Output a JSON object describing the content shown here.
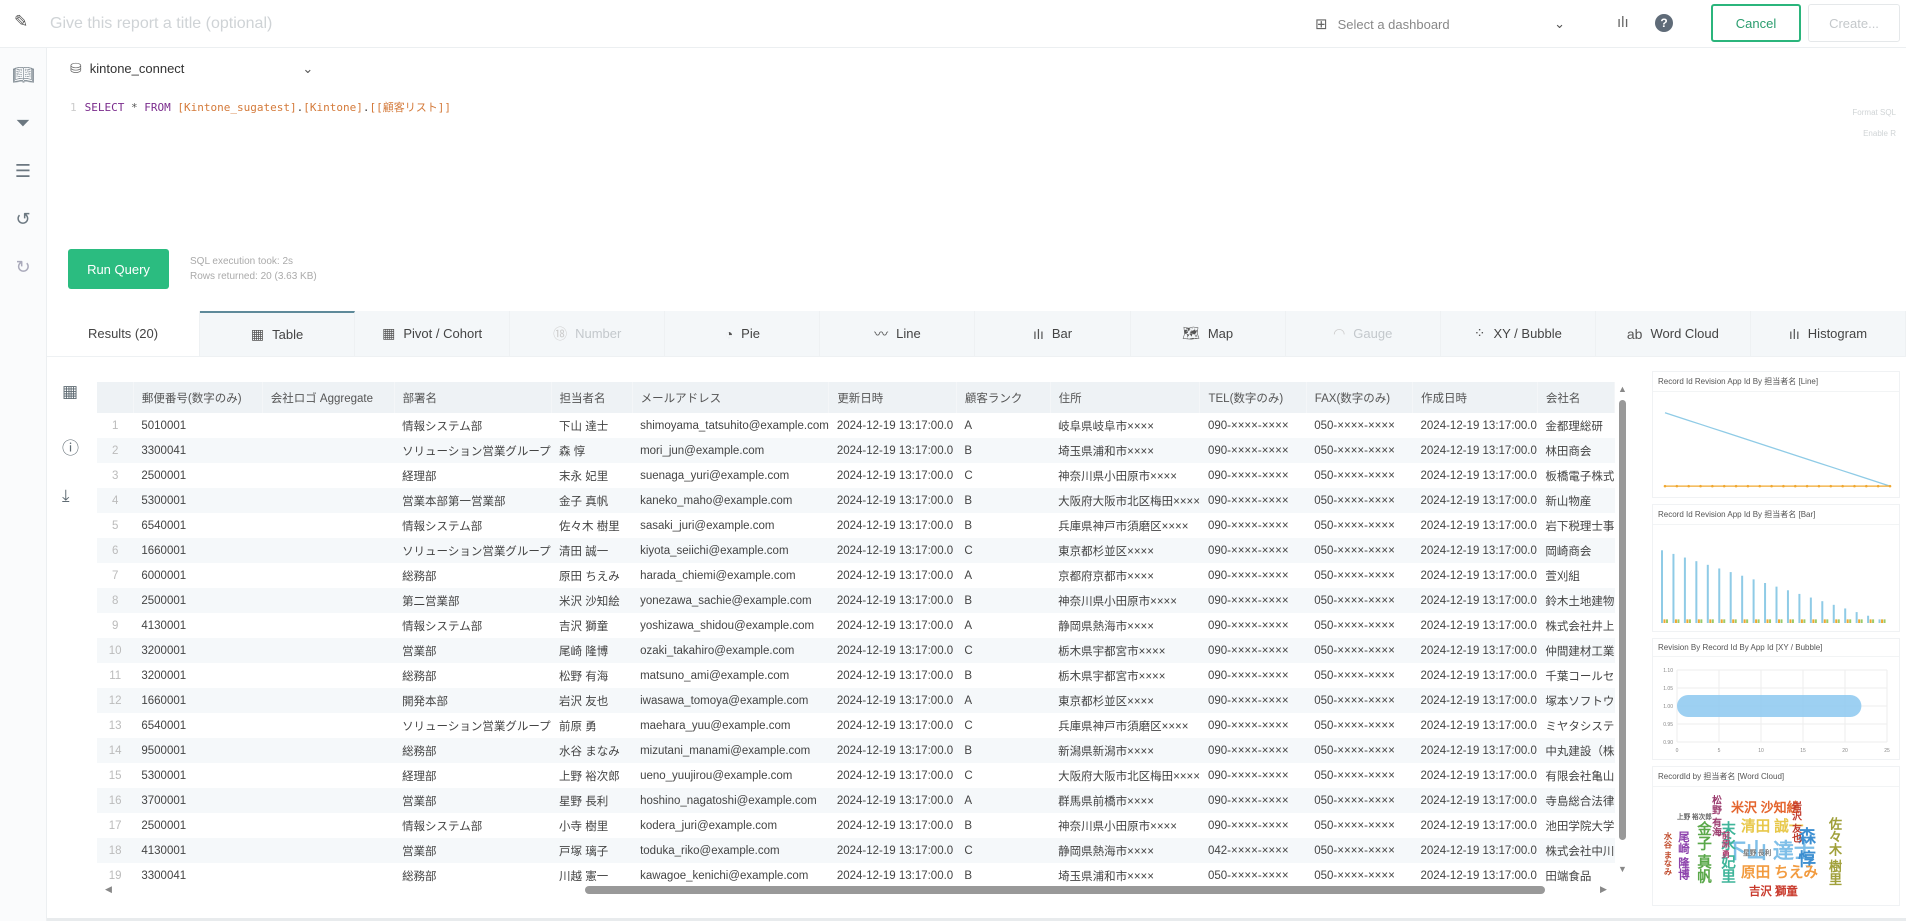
{
  "header": {
    "title_placeholder": "Give this report a title (optional)",
    "dashboard_placeholder": "Select a dashboard",
    "cancel_label": "Cancel",
    "create_label": "Create..."
  },
  "editor": {
    "connection": "kintone_connect",
    "line_number": "1",
    "sql": {
      "select": "SELECT",
      "star": " * ",
      "from": "FROM",
      "db": " [Kintone_sugatest]",
      "dot1": ".",
      "schema": "[Kintone]",
      "dot2": ".",
      "table": "[[顧客リスト]]"
    },
    "format_sql": "Format SQL",
    "enable_r": "Enable R",
    "run_label": "Run Query",
    "exec_time": "SQL execution took: 2s",
    "rows_returned": "Rows returned: 20 (3.63 KB)"
  },
  "tabs": [
    {
      "label": "Results (20)",
      "icon": "",
      "state": "active"
    },
    {
      "label": "Table",
      "icon": "table-icon",
      "state": "normal"
    },
    {
      "label": "Pivot / Cohort",
      "icon": "pivot-icon",
      "state": "normal"
    },
    {
      "label": "Number",
      "icon": "number-icon",
      "state": "disabled"
    },
    {
      "label": "Pie",
      "icon": "pie-icon",
      "state": "normal"
    },
    {
      "label": "Line",
      "icon": "line-icon",
      "state": "normal"
    },
    {
      "label": "Bar",
      "icon": "bar-icon",
      "state": "normal"
    },
    {
      "label": "Map",
      "icon": "map-icon",
      "state": "normal"
    },
    {
      "label": "Gauge",
      "icon": "gauge-icon",
      "state": "disabled"
    },
    {
      "label": "XY / Bubble",
      "icon": "bubble-icon",
      "state": "normal"
    },
    {
      "label": "Word Cloud",
      "icon": "word-cloud-icon",
      "state": "normal"
    },
    {
      "label": "Histogram",
      "icon": "histogram-icon",
      "state": "normal"
    }
  ],
  "table": {
    "columns": [
      "",
      "郵便番号(数字のみ)",
      "会社ロゴ Aggregate",
      "部署名",
      "担当者名",
      "メールアドレス",
      "更新日時",
      "顧客ランク",
      "住所",
      "TEL(数字のみ)",
      "FAX(数字のみ)",
      "作成日時",
      "会社名"
    ],
    "rows": [
      [
        "1",
        "5010001",
        "",
        "情報システム部",
        "下山 達士",
        "shimoyama_tatsuhito@example.com",
        "2024-12-19 13:17:00.0",
        "A",
        "岐阜県岐阜市××××",
        "090-××××-××××",
        "050-××××-××××",
        "2024-12-19 13:17:00.0",
        "金都理総研"
      ],
      [
        "2",
        "3300041",
        "",
        "ソリューション営業グループ",
        "森 惇",
        "mori_jun@example.com",
        "2024-12-19 13:17:00.0",
        "B",
        "埼玉県浦和市××××",
        "090-××××-××××",
        "050-××××-××××",
        "2024-12-19 13:17:00.0",
        "林田商会"
      ],
      [
        "3",
        "2500001",
        "",
        "経理部",
        "末永 妃里",
        "suenaga_yuri@example.com",
        "2024-12-19 13:17:00.0",
        "C",
        "神奈川県小田原市××××",
        "090-××××-××××",
        "050-××××-××××",
        "2024-12-19 13:17:00.0",
        "板橋電子株式"
      ],
      [
        "4",
        "5300001",
        "",
        "営業本部第一営業部",
        "金子 真帆",
        "kaneko_maho@example.com",
        "2024-12-19 13:17:00.0",
        "B",
        "大阪府大阪市北区梅田××××",
        "090-××××-××××",
        "050-××××-××××",
        "2024-12-19 13:17:00.0",
        "新山物産"
      ],
      [
        "5",
        "6540001",
        "",
        "情報システム部",
        "佐々木 樹里",
        "sasaki_juri@example.com",
        "2024-12-19 13:17:00.0",
        "B",
        "兵庫県神戸市須磨区××××",
        "090-××××-××××",
        "050-××××-××××",
        "2024-12-19 13:17:00.0",
        "岩下税理士事"
      ],
      [
        "6",
        "1660001",
        "",
        "ソリューション営業グループ",
        "清田 誠一",
        "kiyota_seiichi@example.com",
        "2024-12-19 13:17:00.0",
        "C",
        "東京都杉並区××××",
        "090-××××-××××",
        "050-××××-××××",
        "2024-12-19 13:17:00.0",
        "岡崎商会"
      ],
      [
        "7",
        "6000001",
        "",
        "総務部",
        "原田 ちえみ",
        "harada_chiemi@example.com",
        "2024-12-19 13:17:00.0",
        "A",
        "京都府京都市××××",
        "090-××××-××××",
        "050-××××-××××",
        "2024-12-19 13:17:00.0",
        "萱刈組"
      ],
      [
        "8",
        "2500001",
        "",
        "第二営業部",
        "米沢 沙知絵",
        "yonezawa_sachie@example.com",
        "2024-12-19 13:17:00.0",
        "B",
        "神奈川県小田原市××××",
        "090-××××-××××",
        "050-××××-××××",
        "2024-12-19 13:17:00.0",
        "鈴木土地建物"
      ],
      [
        "9",
        "4130001",
        "",
        "情報システム部",
        "吉沢 獅童",
        "yoshizawa_shidou@example.com",
        "2024-12-19 13:17:00.0",
        "A",
        "静岡県熱海市××××",
        "090-××××-××××",
        "050-××××-××××",
        "2024-12-19 13:17:00.0",
        "株式会社井上"
      ],
      [
        "10",
        "3200001",
        "",
        "営業部",
        "尾崎 隆博",
        "ozaki_takahiro@example.com",
        "2024-12-19 13:17:00.0",
        "C",
        "栃木県宇都宮市××××",
        "090-××××-××××",
        "050-××××-××××",
        "2024-12-19 13:17:00.0",
        "仲間建材工業"
      ],
      [
        "11",
        "3200001",
        "",
        "総務部",
        "松野 有海",
        "matsuno_ami@example.com",
        "2024-12-19 13:17:00.0",
        "B",
        "栃木県宇都宮市××××",
        "090-××××-××××",
        "050-××××-××××",
        "2024-12-19 13:17:00.0",
        "千葉コールセ"
      ],
      [
        "12",
        "1660001",
        "",
        "開発本部",
        "岩沢 友也",
        "iwasawa_tomoya@example.com",
        "2024-12-19 13:17:00.0",
        "A",
        "東京都杉並区××××",
        "090-××××-××××",
        "050-××××-××××",
        "2024-12-19 13:17:00.0",
        "塚本ソフトウ"
      ],
      [
        "13",
        "6540001",
        "",
        "ソリューション営業グループ",
        "前原 勇",
        "maehara_yuu@example.com",
        "2024-12-19 13:17:00.0",
        "C",
        "兵庫県神戸市須磨区××××",
        "090-××××-××××",
        "050-××××-××××",
        "2024-12-19 13:17:00.0",
        "ミヤタシステ"
      ],
      [
        "14",
        "9500001",
        "",
        "総務部",
        "水谷 まなみ",
        "mizutani_manami@example.com",
        "2024-12-19 13:17:00.0",
        "B",
        "新潟県新潟市××××",
        "090-××××-××××",
        "050-××××-××××",
        "2024-12-19 13:17:00.0",
        "中丸建設（株"
      ],
      [
        "15",
        "5300001",
        "",
        "経理部",
        "上野 裕次郎",
        "ueno_yuujirou@example.com",
        "2024-12-19 13:17:00.0",
        "C",
        "大阪府大阪市北区梅田××××",
        "090-××××-××××",
        "050-××××-××××",
        "2024-12-19 13:17:00.0",
        "有限会社亀山"
      ],
      [
        "16",
        "3700001",
        "",
        "営業部",
        "星野 長利",
        "hoshino_nagatoshi@example.com",
        "2024-12-19 13:17:00.0",
        "A",
        "群馬県前橋市××××",
        "090-××××-××××",
        "050-××××-××××",
        "2024-12-19 13:17:00.0",
        "寺島総合法律"
      ],
      [
        "17",
        "2500001",
        "",
        "情報システム部",
        "小寺 樹里",
        "kodera_juri@example.com",
        "2024-12-19 13:17:00.0",
        "B",
        "神奈川県小田原市××××",
        "090-××××-××××",
        "050-××××-××××",
        "2024-12-19 13:17:00.0",
        "池田学院大学"
      ],
      [
        "18",
        "4130001",
        "",
        "営業部",
        "戸塚 璃子",
        "toduka_riko@example.com",
        "2024-12-19 13:17:00.0",
        "C",
        "静岡県熱海市××××",
        "042-××××-××××",
        "050-××××-××××",
        "2024-12-19 13:17:00.0",
        "株式会社中川"
      ],
      [
        "19",
        "3300041",
        "",
        "総務部",
        "川越 憲一",
        "kawagoe_kenichi@example.com",
        "2024-12-19 13:17:00.0",
        "B",
        "埼玉県浦和市××××",
        "050-××××-××××",
        "050-××××-××××",
        "2024-12-19 13:17:00.0",
        "田端食品"
      ]
    ]
  },
  "chart_data": [
    {
      "type": "line",
      "title": "Record Id Revision App Id By 担当者名 [Line]",
      "series": [
        {
          "values": [
            20,
            19,
            18,
            17,
            16,
            15,
            14,
            13,
            12,
            11,
            10,
            9,
            8,
            7,
            6,
            5,
            4,
            3,
            2,
            1
          ],
          "color": "#8fcbe6"
        },
        {
          "values": [
            1,
            1,
            1,
            1,
            1,
            1,
            1,
            1,
            1,
            1,
            1,
            1,
            1,
            1,
            1,
            1,
            1,
            1,
            1,
            1
          ],
          "color": "#f0a830"
        }
      ],
      "ylim": [
        0,
        22
      ]
    },
    {
      "type": "bar",
      "title": "Record Id Revision App Id By 担当者名 [Bar]",
      "series": [
        {
          "values": [
            20,
            19,
            18,
            17,
            16,
            15,
            14,
            13,
            12,
            11,
            10,
            9,
            8,
            7,
            6,
            5,
            4,
            3,
            2,
            1
          ],
          "color": "#8fcbe6"
        },
        {
          "values": [
            1,
            1,
            1,
            1,
            1,
            1,
            1,
            1,
            1,
            1,
            1,
            1,
            1,
            1,
            1,
            1,
            1,
            1,
            1,
            1
          ],
          "color": "#f0a830"
        },
        {
          "values": [
            1,
            1,
            1,
            1,
            1,
            1,
            1,
            1,
            1,
            1,
            1,
            1,
            1,
            1,
            1,
            1,
            1,
            1,
            1,
            1
          ],
          "color": "#9acb6a"
        }
      ],
      "ylim": [
        0,
        22
      ]
    },
    {
      "type": "scatter",
      "title": "Revision By Record Id By App Id [XY / Bubble]",
      "xlim": [
        0,
        25
      ],
      "ylim": [
        0.9,
        1.1
      ],
      "xticks": [
        "0",
        "5",
        "10",
        "15",
        "20",
        "25"
      ],
      "yticks": [
        "0.90",
        "0.95",
        "1.00",
        "1.05",
        "1.10"
      ],
      "bubble": {
        "x_from": 0,
        "x_to": 21,
        "y": 1.0,
        "color": "#8cc8f0"
      },
      "grid": true
    },
    {
      "type": "word-cloud",
      "title": "RecordId by 担当者名 [Word Cloud]",
      "words": [
        {
          "text": "下山 達士",
          "weight": 10,
          "color": "#7fbfe8"
        },
        {
          "text": "森 惇",
          "weight": 8,
          "color": "#3d8fd1"
        },
        {
          "text": "原田 ちえみ",
          "weight": 6,
          "color": "#f29b3f"
        },
        {
          "text": "清田 誠一",
          "weight": 6,
          "color": "#e8c84a"
        },
        {
          "text": "米沢 沙知絵",
          "weight": 5,
          "color": "#e4652e"
        },
        {
          "text": "金子 真帆",
          "weight": 6,
          "color": "#5aa84a"
        },
        {
          "text": "末永 妃里",
          "weight": 6,
          "color": "#3fb59a"
        },
        {
          "text": "佐々木 樹里",
          "weight": 5,
          "color": "#a0a03a"
        },
        {
          "text": "吉沢 獅童",
          "weight": 4,
          "color": "#c8392b"
        },
        {
          "text": "尾崎 隆博",
          "weight": 4,
          "color": "#8e44ad"
        },
        {
          "text": "松野 有海",
          "weight": 3,
          "color": "#9b3c6e"
        },
        {
          "text": "岩沢 友也",
          "weight": 3,
          "color": "#c0392b"
        },
        {
          "text": "水谷 まなみ",
          "weight": 2,
          "color": "#c04a2b"
        },
        {
          "text": "上野 裕次郎",
          "weight": 1,
          "color": "#666"
        },
        {
          "text": "前原 勇",
          "weight": 2,
          "color": "#b04070"
        },
        {
          "text": "星野 長利",
          "weight": 1,
          "color": "#777"
        }
      ]
    }
  ]
}
